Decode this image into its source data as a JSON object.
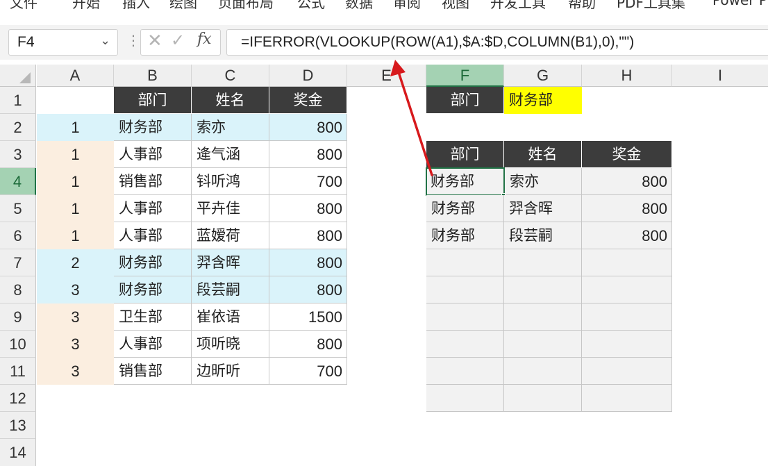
{
  "ribbon": {
    "tabs": [
      "文件",
      "开始",
      "插入",
      "绘图",
      "页面布局",
      "公式",
      "数据",
      "审阅",
      "视图",
      "开发工具",
      "帮助",
      "PDF工具集",
      "Power Pi"
    ]
  },
  "formula_bar": {
    "name_box": "F4",
    "cancel_icon": "✕",
    "enter_icon": "✓",
    "fx_label": "fx",
    "formula": "=IFERROR(VLOOKUP(ROW(A1),$A:$D,COLUMN(B1),0),\"\")"
  },
  "columns": [
    "A",
    "B",
    "C",
    "D",
    "E",
    "F",
    "G",
    "H",
    "I"
  ],
  "rows": [
    "1",
    "2",
    "3",
    "4",
    "5",
    "6",
    "7",
    "8",
    "9",
    "10",
    "11",
    "12",
    "13",
    "14"
  ],
  "selected_cell": "F4",
  "source_table": {
    "headers": [
      "部门",
      "姓名",
      "奖金"
    ],
    "rows": [
      {
        "a": "1",
        "dept": "财务部",
        "name": "索亦",
        "bonus": "800"
      },
      {
        "a": "1",
        "dept": "人事部",
        "name": "逄气涵",
        "bonus": "800"
      },
      {
        "a": "1",
        "dept": "销售部",
        "name": "钭听鸿",
        "bonus": "700"
      },
      {
        "a": "1",
        "dept": "人事部",
        "name": "平卉佳",
        "bonus": "800"
      },
      {
        "a": "1",
        "dept": "人事部",
        "name": "蓝嫒荷",
        "bonus": "800"
      },
      {
        "a": "2",
        "dept": "财务部",
        "name": "羿含晖",
        "bonus": "800"
      },
      {
        "a": "3",
        "dept": "财务部",
        "name": "段芸嗣",
        "bonus": "800"
      },
      {
        "a": "3",
        "dept": "卫生部",
        "name": "崔依语",
        "bonus": "1500"
      },
      {
        "a": "3",
        "dept": "人事部",
        "name": "项听晓",
        "bonus": "800"
      },
      {
        "a": "3",
        "dept": "销售部",
        "name": "边昕听",
        "bonus": "700"
      }
    ]
  },
  "criteria": {
    "label": "部门",
    "value": "财务部"
  },
  "result_table": {
    "headers": [
      "部门",
      "姓名",
      "奖金"
    ],
    "rows": [
      {
        "dept": "财务部",
        "name": "索亦",
        "bonus": "800"
      },
      {
        "dept": "财务部",
        "name": "羿含晖",
        "bonus": "800"
      },
      {
        "dept": "财务部",
        "name": "段芸嗣",
        "bonus": "800"
      }
    ]
  },
  "colors": {
    "header_dark": "#3c3c3c",
    "highlight_blue": "#daf3fa",
    "highlight_tan": "#fbeee0",
    "criteria_yellow": "#ffff00",
    "arrow_red": "#d7191c",
    "excel_green": "#217346"
  }
}
